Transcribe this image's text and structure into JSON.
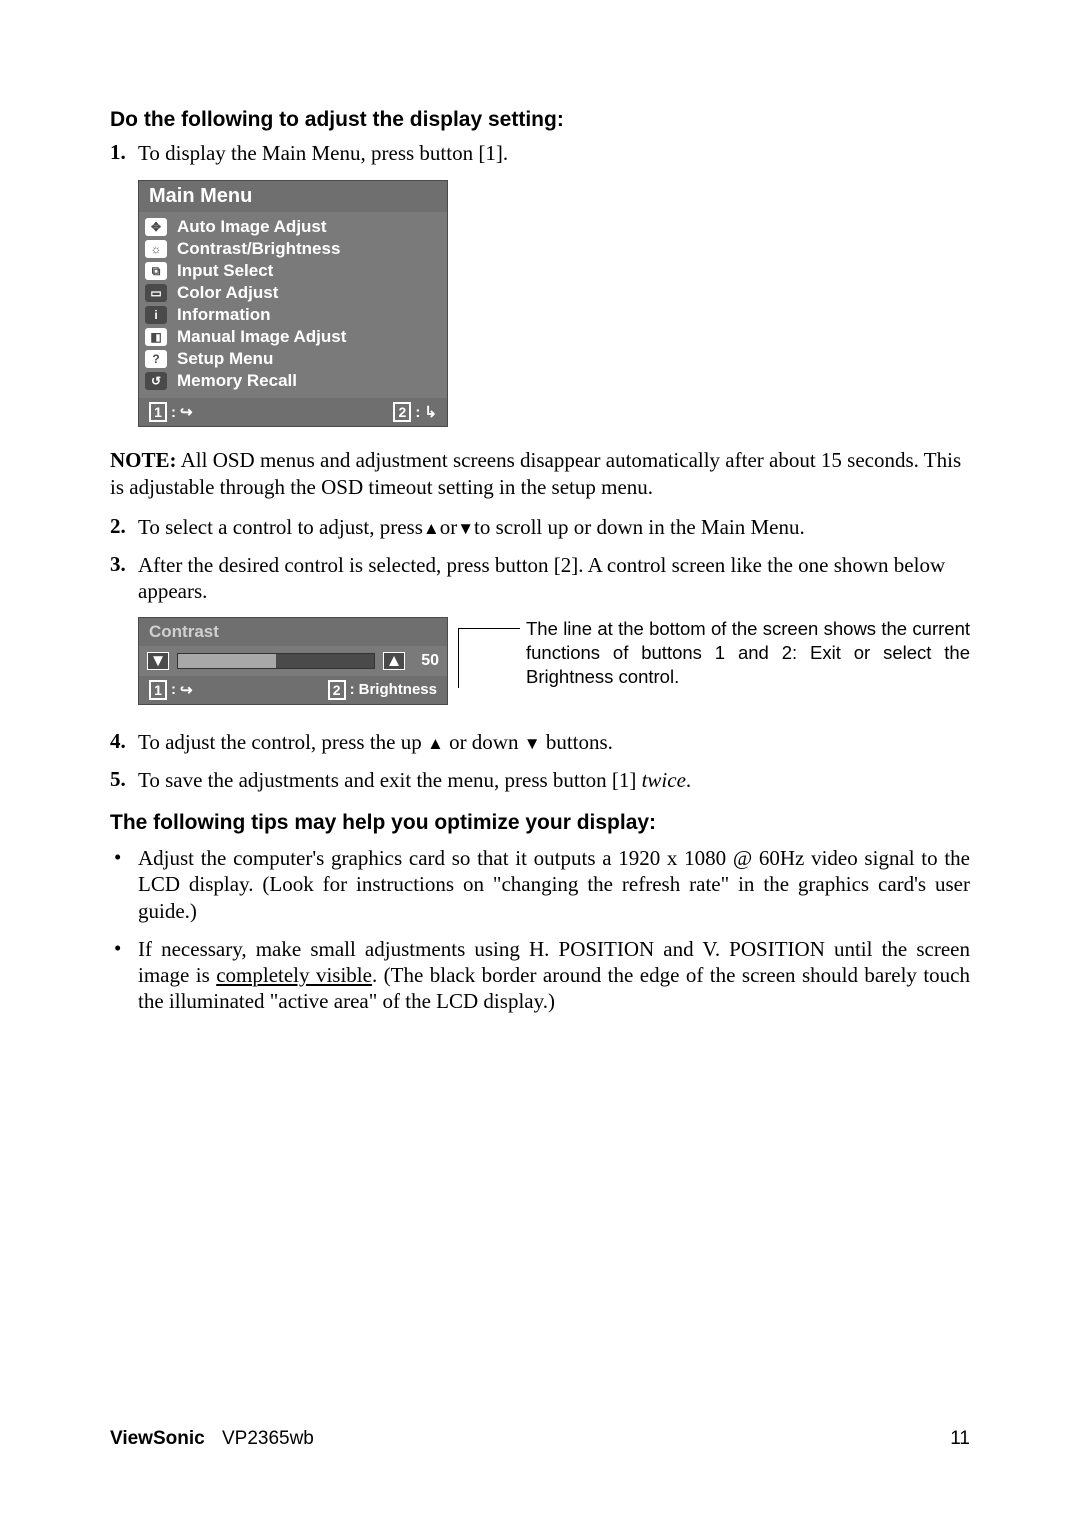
{
  "section1_heading": "Do the following to adjust the display setting:",
  "step1": {
    "num": "1.",
    "text": "To display the Main Menu, press button [1]."
  },
  "main_menu": {
    "title": "Main Menu",
    "items": [
      {
        "label": "Auto Image Adjust",
        "glyph": "✥"
      },
      {
        "label": "Contrast/Brightness",
        "glyph": "☼"
      },
      {
        "label": "Input Select",
        "glyph": "⧉"
      },
      {
        "label": "Color Adjust",
        "glyph": "▭"
      },
      {
        "label": "Information",
        "glyph": "i"
      },
      {
        "label": "Manual Image Adjust",
        "glyph": "◧"
      },
      {
        "label": "Setup Menu",
        "glyph": "?"
      },
      {
        "label": "Memory Recall",
        "glyph": "↺"
      }
    ],
    "footer_left_key": "1",
    "footer_left_sep": ":",
    "footer_right_key": "2",
    "footer_right_sep": ":"
  },
  "note_label": "NOTE:",
  "note_body": " All OSD menus and adjustment screens disappear automatically after about 15 seconds. This is adjustable through the OSD timeout setting in the setup menu.",
  "step2": {
    "num": "2.",
    "pre": "To select a control to adjust, press",
    "post": "to scroll up or down in the Main Menu.",
    "or": "or"
  },
  "step3": {
    "num": "3.",
    "text": "After the desired control is selected, press button [2]. A control screen like the one shown below appears."
  },
  "contrast_box": {
    "title": "Contrast",
    "value": "50",
    "footer_left_key": "1",
    "footer_left_sep": ":",
    "footer_right_key": "2",
    "footer_right_sep": ":",
    "footer_right_label": "Brightness"
  },
  "callout_text": "The line at the bottom of the screen shows the current functions of buttons 1 and 2: Exit or select the Brightness control.",
  "step4": {
    "num": "4.",
    "pre": "To adjust the control, press the up ",
    "mid": " or down ",
    "post": " buttons."
  },
  "step5": {
    "num": "5.",
    "pre": "To save the adjustments and exit the menu, press button [1] ",
    "ital": "twice",
    "post": "."
  },
  "section2_heading": "The following tips may help you optimize your display:",
  "tip1": "Adjust the computer's graphics card so that it outputs a 1920 x 1080 @ 60Hz video signal to the LCD display. (Look for instructions on \"changing the refresh rate\" in the graphics card's user guide.)",
  "tip2_pre": "If necessary, make small adjustments using H. POSITION and V. POSITION until the screen image is ",
  "tip2_underline": "completely visible",
  "tip2_post": ". (The black border around the edge of the screen should barely touch the illuminated \"active area\" of the LCD display.)",
  "footer": {
    "brand": "ViewSonic",
    "model": "VP2365wb",
    "page": "11"
  }
}
